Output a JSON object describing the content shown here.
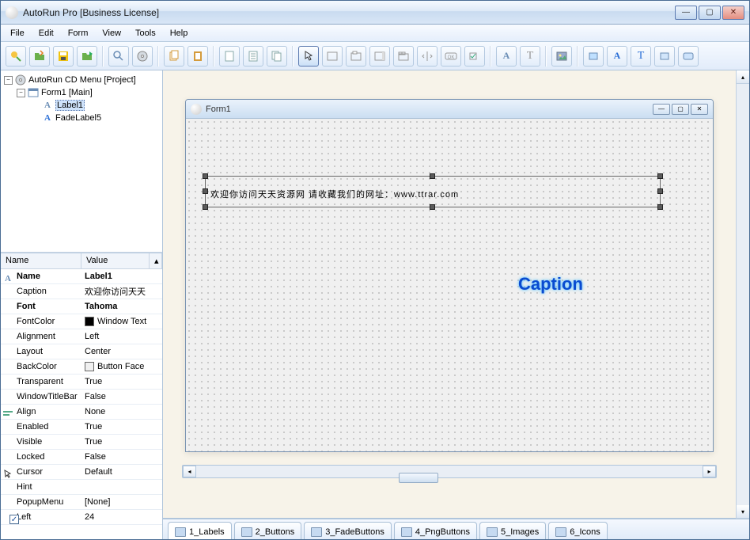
{
  "app": {
    "title": "AutoRun Pro [Business License]"
  },
  "menus": [
    "File",
    "Edit",
    "Form",
    "View",
    "Tools",
    "Help"
  ],
  "tree": {
    "root": "AutoRun CD Menu [Project]",
    "form": "Form1 [Main]",
    "children": [
      "Label1",
      "FadeLabel5"
    ]
  },
  "props": {
    "headers": {
      "name": "Name",
      "value": "Value"
    },
    "rows": [
      {
        "icon": "A",
        "name": "Name",
        "value": "Label1",
        "bold": true
      },
      {
        "name": "Caption",
        "value": "欢迎你访问天天"
      },
      {
        "name": "Font",
        "value": "Tahoma",
        "bold": true
      },
      {
        "icon": "swatch",
        "name": "FontColor",
        "value": "Window Text",
        "swatch": "#000000"
      },
      {
        "name": "Alignment",
        "value": "Left"
      },
      {
        "name": "Layout",
        "value": "Center"
      },
      {
        "icon": "swatch",
        "name": "BackColor",
        "value": "Button Face",
        "swatch": "#f0f0f0"
      },
      {
        "name": "Transparent",
        "value": "True"
      },
      {
        "name": "WindowTitleBar",
        "value": "False"
      },
      {
        "icon": "align",
        "name": "Align",
        "value": "None"
      },
      {
        "name": "Enabled",
        "value": "True"
      },
      {
        "name": "Visible",
        "value": "True"
      },
      {
        "name": "Locked",
        "value": "False"
      },
      {
        "icon": "cursor",
        "name": "Cursor",
        "value": "Default"
      },
      {
        "name": "Hint",
        "value": ""
      },
      {
        "name": "PopupMenu",
        "value": "[None]"
      },
      {
        "icon": "check",
        "name": "Left",
        "value": "24"
      }
    ]
  },
  "form": {
    "title": "Form1",
    "label_text": "欢迎你访问天天资源网 请收藏我们的网址：www.ttrar.com",
    "caption_text": "Caption"
  },
  "tabs": [
    "1_Labels",
    "2_Buttons",
    "3_FadeButtons",
    "4_PngButtons",
    "5_Images",
    "6_Icons"
  ]
}
